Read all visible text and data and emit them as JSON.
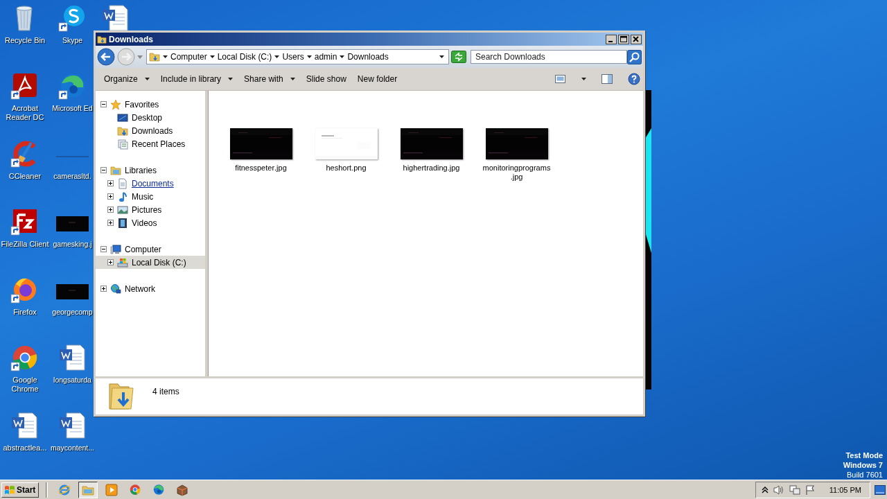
{
  "desktop": {
    "icons": [
      {
        "label": "Recycle Bin",
        "kind": "recycle-bin",
        "shortcut": false
      },
      {
        "label": "Acrobat Reader DC",
        "kind": "pdf-app",
        "shortcut": true
      },
      {
        "label": "CCleaner",
        "kind": "cleaner-app",
        "shortcut": true
      },
      {
        "label": "FileZilla Client",
        "kind": "ftp-app",
        "shortcut": true
      },
      {
        "label": "Firefox",
        "kind": "fox-browser",
        "shortcut": true
      },
      {
        "label": "Google Chrome",
        "kind": "ring-browser",
        "shortcut": true
      },
      {
        "label": "abstractlea...",
        "kind": "word-doc",
        "shortcut": false
      },
      {
        "label": "Skype",
        "kind": "chat-app",
        "shortcut": true
      },
      {
        "label": "Microsoft Ed",
        "kind": "wave-browser",
        "shortcut": true
      },
      {
        "label": "camerasltd.",
        "kind": "blank-image",
        "shortcut": false
      },
      {
        "label": "gamesking.j",
        "kind": "dark-image",
        "shortcut": false
      },
      {
        "label": "georgecomp",
        "kind": "dark-image",
        "shortcut": false
      },
      {
        "label": "longsaturda",
        "kind": "word-doc",
        "shortcut": false
      },
      {
        "label": "maycontent...",
        "kind": "word-doc",
        "shortcut": false
      },
      {
        "kind": "word-doc",
        "shortcut": false
      }
    ],
    "system_notice": [
      "Test Mode",
      "Windows 7",
      "Build 7601"
    ]
  },
  "explorer": {
    "title": "Downloads",
    "breadcrumbs": [
      "Computer",
      "Local Disk (C:)",
      "Users",
      "admin",
      "Downloads"
    ],
    "search": {
      "placeholder": "Search Downloads"
    },
    "toolbar": [
      {
        "label": "Organize",
        "dropdown": true
      },
      {
        "label": "Include in library",
        "dropdown": true
      },
      {
        "label": "Share with",
        "dropdown": true
      },
      {
        "label": "Slide show",
        "dropdown": false
      },
      {
        "label": "New folder",
        "dropdown": false
      }
    ],
    "nav_tree": [
      {
        "label": "Favorites",
        "kind": "star",
        "expanded": true,
        "selected": false,
        "hovered": false,
        "children": [
          {
            "label": "Desktop",
            "kind": "monitor",
            "selected": false,
            "hovered": false
          },
          {
            "label": "Downloads",
            "kind": "download-folder",
            "selected": false,
            "hovered": false
          },
          {
            "label": "Recent Places",
            "kind": "recent",
            "selected": false,
            "hovered": false
          }
        ]
      },
      {
        "label": "Libraries",
        "kind": "library",
        "expanded": true,
        "selected": false,
        "hovered": false,
        "children": [
          {
            "label": "Documents",
            "kind": "document",
            "expanded": false,
            "selected": false,
            "hovered": true
          },
          {
            "label": "Music",
            "kind": "music",
            "expanded": false,
            "selected": false,
            "hovered": false
          },
          {
            "label": "Pictures",
            "kind": "pictures",
            "expanded": false,
            "selected": false,
            "hovered": false
          },
          {
            "label": "Videos",
            "kind": "videos",
            "expanded": false,
            "selected": false,
            "hovered": false
          }
        ]
      },
      {
        "label": "Computer",
        "kind": "computer",
        "expanded": true,
        "selected": false,
        "hovered": false,
        "children": [
          {
            "label": "Local Disk (C:)",
            "kind": "drive",
            "expanded": false,
            "selected": true,
            "hovered": false
          }
        ]
      },
      {
        "label": "Network",
        "kind": "network",
        "expanded": false,
        "selected": false,
        "hovered": false
      }
    ],
    "files": [
      {
        "name": "fitnesspeter.jpg",
        "kind": "dark"
      },
      {
        "name": "heshort.png",
        "kind": "light"
      },
      {
        "name": "highertrading.jpg",
        "kind": "dark"
      },
      {
        "name": "monitoringprograms.jpg",
        "kind": "dark"
      }
    ],
    "status": "4 items"
  },
  "taskbar": {
    "start": "Start",
    "apps": [
      {
        "kind": "ie",
        "selected": false
      },
      {
        "kind": "folder",
        "selected": true
      },
      {
        "kind": "media",
        "selected": false
      },
      {
        "kind": "ring-browser",
        "selected": false
      },
      {
        "kind": "wave-browser",
        "selected": false
      },
      {
        "kind": "package",
        "selected": false
      }
    ],
    "clock": "11:05 PM"
  }
}
